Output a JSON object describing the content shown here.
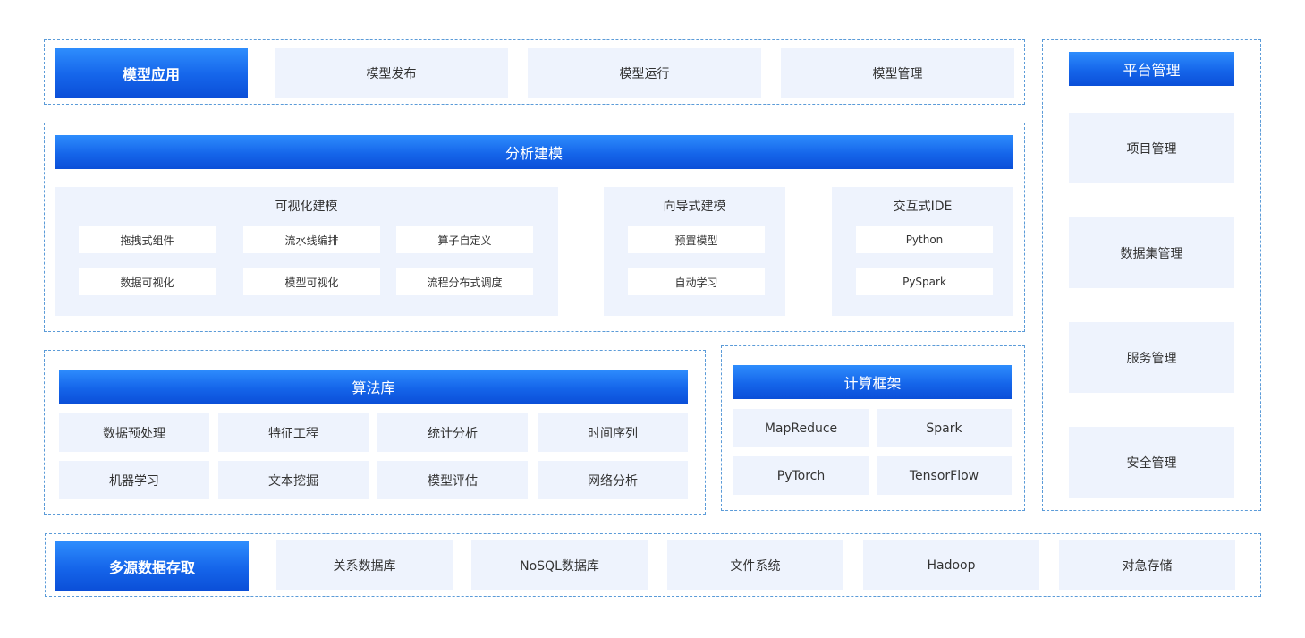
{
  "model_app": {
    "title": "模型应用",
    "items": [
      "模型发布",
      "模型运行",
      "模型管理"
    ]
  },
  "analysis": {
    "title": "分析建模",
    "visual": {
      "title": "可视化建模",
      "items": [
        "拖拽式组件",
        "流水线编排",
        "算子自定义",
        "数据可视化",
        "模型可视化",
        "流程分布式调度"
      ]
    },
    "guided": {
      "title": "向导式建模",
      "items": [
        "预置模型",
        "自动学习"
      ]
    },
    "ide": {
      "title": "交互式IDE",
      "items": [
        "Python",
        "PySpark"
      ]
    }
  },
  "algorithms": {
    "title": "算法库",
    "items": [
      "数据预处理",
      "特征工程",
      "统计分析",
      "时间序列",
      "机器学习",
      "文本挖掘",
      "模型评估",
      "网络分析"
    ]
  },
  "compute": {
    "title": "计算框架",
    "items": [
      "MapReduce",
      "Spark",
      "PyTorch",
      "TensorFlow"
    ]
  },
  "platform": {
    "title": "平台管理",
    "items": [
      "项目管理",
      "数据集管理",
      "服务管理",
      "安全管理"
    ]
  },
  "storage": {
    "title": "多源数据存取",
    "items": [
      "关系数据库",
      "NoSQL数据库",
      "文件系统",
      "Hadoop",
      "对急存储"
    ]
  },
  "colors": {
    "accent_blue": "#1565ea",
    "tile_background": "#eef3fd",
    "dashed_border": "#5b9bd8"
  }
}
